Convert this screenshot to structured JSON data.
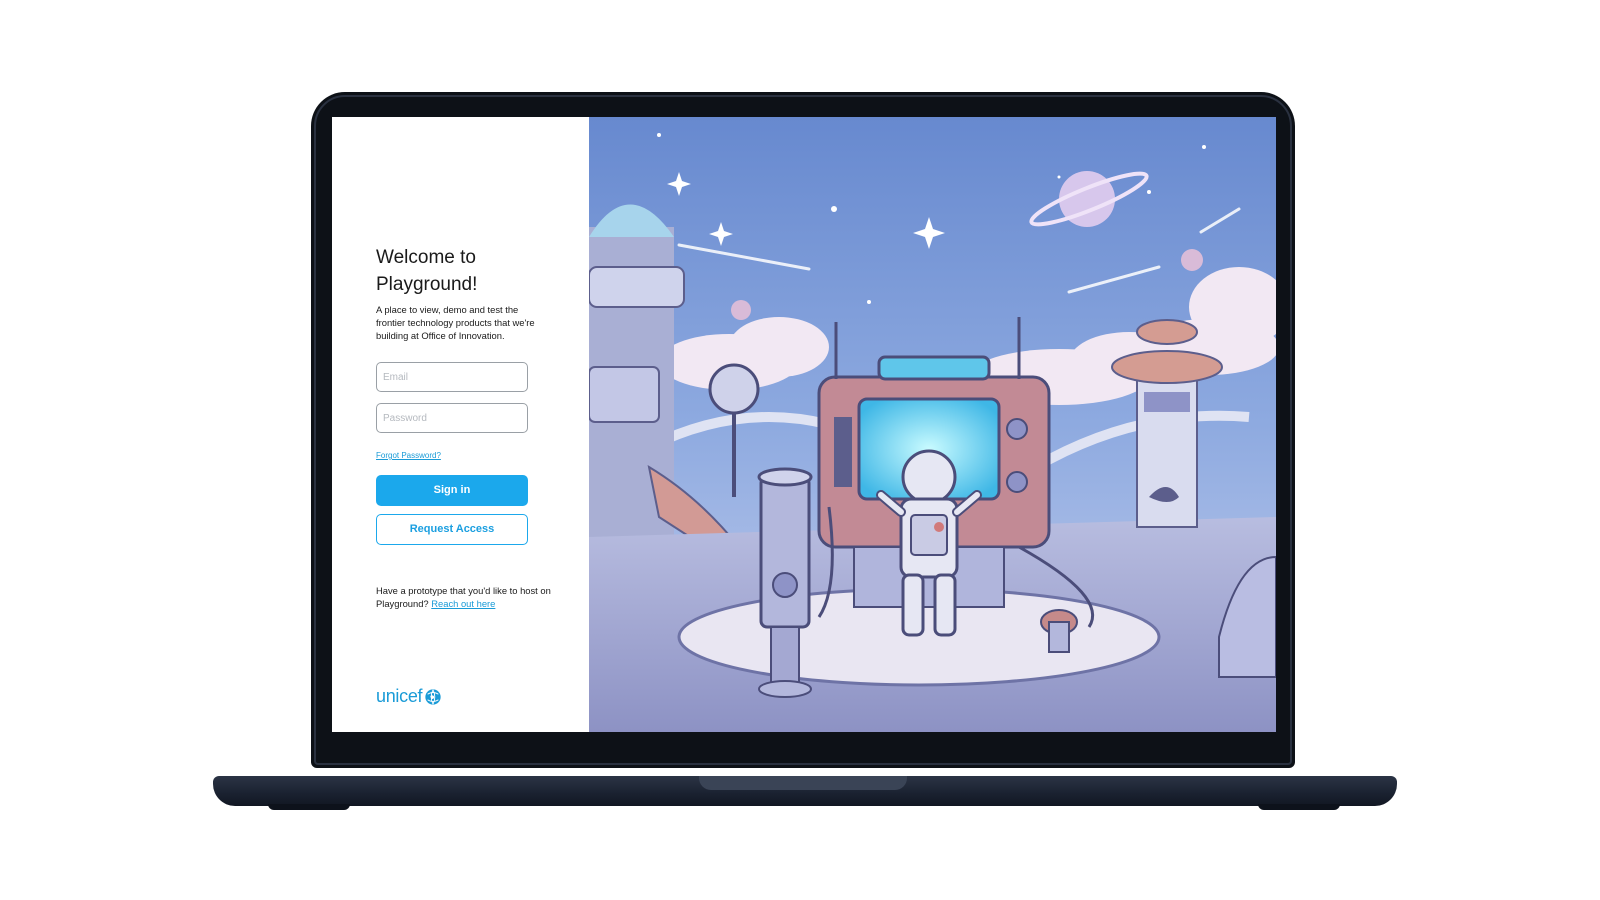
{
  "login": {
    "title": "Welcome to Playground!",
    "subtitle": "A place to view, demo and test the frontier technology products that we're building at Office of Innovation.",
    "email_placeholder": "Email",
    "password_placeholder": "Password",
    "forgot_link": "Forgot Password?",
    "signin_label": "Sign in",
    "request_label": "Request Access",
    "prototype_text": "Have a prototype that you'd like to host on Playground?",
    "prototype_link": "Reach out here",
    "logo_text": "unicef"
  },
  "colors": {
    "accent": "#1ba8ec",
    "link": "#1a9bd7",
    "sky": "#6f8fd2",
    "device": "#0d1117"
  },
  "illustration": {
    "icon_name": "astronaut-space-station-illustration"
  }
}
